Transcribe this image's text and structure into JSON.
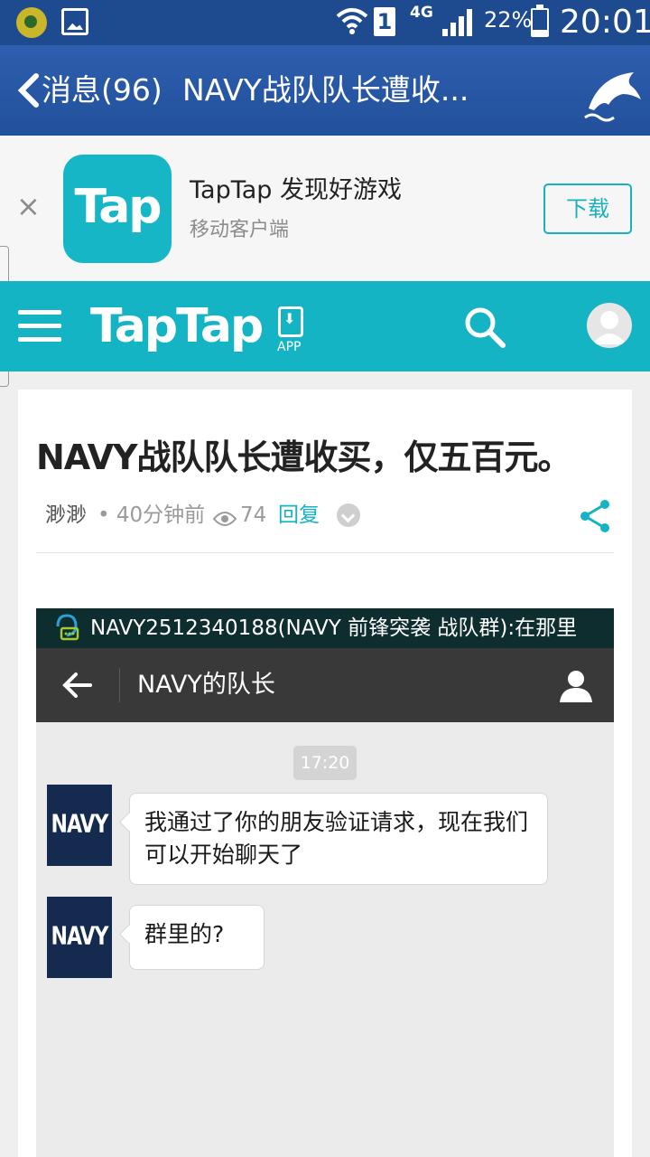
{
  "status_bar": {
    "network": "4G",
    "sim_slot": "1",
    "battery_percent": "22%",
    "battery_level": 0.22,
    "time": "20:01"
  },
  "title_bar": {
    "back_label": "消息(96)",
    "title": "NAVY战队队长遭收..."
  },
  "ad_banner": {
    "close_symbol": "×",
    "app_icon_text": "Tap",
    "app_name": "TapTap 发现好游戏",
    "subtitle": "移动客户端",
    "download_label": "下载"
  },
  "site_nav": {
    "logo": "TapTap",
    "app_label": "APP"
  },
  "article": {
    "title": "NAVY战队队长遭收买，仅五百元。",
    "author": "渺渺",
    "time": "• 40分钟前",
    "views": "74",
    "reply_label": "回复"
  },
  "embedded_screenshot": {
    "notification": "NAVY2512340188(NAVY 前锋突袭 战队群):在那里",
    "chat_title": "NAVY的队长",
    "timestamp": "17:20",
    "messages": [
      {
        "avatar": "NAVY",
        "text": "我通过了你的朋友验证请求，现在我们可以开始聊天了"
      },
      {
        "avatar": "NAVY",
        "text": "群里的?"
      }
    ]
  },
  "colors": {
    "status_bar": "#1e4b8f",
    "title_bar": "#2d5fae",
    "accent": "#14b4c5",
    "chat_header": "#393939",
    "navy_avatar": "#142a4f"
  }
}
